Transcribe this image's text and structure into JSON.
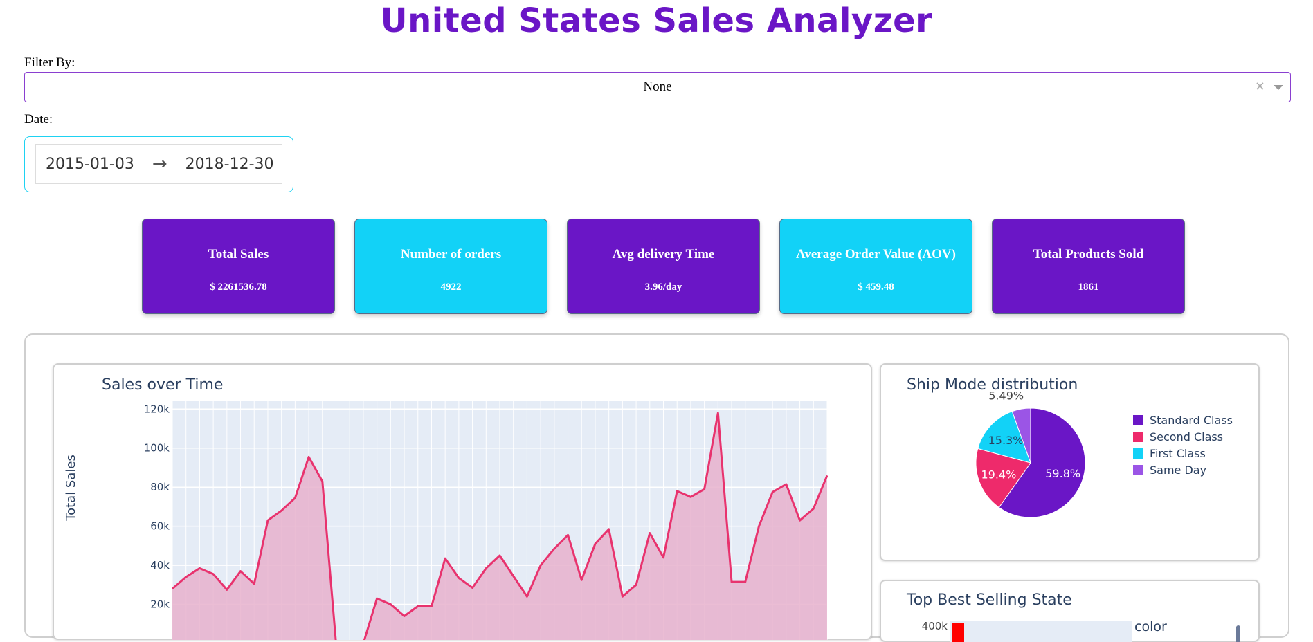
{
  "header": {
    "title": "United States Sales Analyzer"
  },
  "filter": {
    "label": "Filter By:",
    "value": "None",
    "clear_glyph": "×"
  },
  "date": {
    "label": "Date:",
    "start": "2015-01-03",
    "arrow": "→",
    "end": "2018-12-30"
  },
  "kpis": [
    {
      "title": "Total Sales",
      "value": "$ 2261536.78",
      "color": "#6a16c6"
    },
    {
      "title": "Number of orders",
      "value": "4922",
      "color": "#12d2f7"
    },
    {
      "title": "Avg delivery Time",
      "value": "3.96/day",
      "color": "#6a16c6"
    },
    {
      "title": "Average Order Value (AOV)",
      "value": "$ 459.48",
      "color": "#12d2f7"
    },
    {
      "title": "Total Products Sold",
      "value": "1861",
      "color": "#6a16c6"
    }
  ],
  "sales_chart": {
    "title": "Sales over Time"
  },
  "pie_chart": {
    "title": "Ship Mode distribution"
  },
  "state_chart": {
    "title": "Top Best Selling State",
    "legend_title": "color"
  },
  "chart_data": [
    {
      "type": "area",
      "title": "Sales over Time",
      "ylabel": "Total Sales",
      "xlabel": "",
      "ylim": [
        0,
        124000
      ],
      "yticks": [
        "20k",
        "40k",
        "60k",
        "80k",
        "100k",
        "120k"
      ],
      "ytick_values": [
        20000,
        40000,
        60000,
        80000,
        100000,
        120000
      ],
      "grid": true,
      "color": "#e8336e",
      "fill": "#e8b1cc",
      "values": [
        28000,
        34000,
        38500,
        35500,
        27500,
        37000,
        30500,
        63000,
        68000,
        74500,
        95500,
        83000,
        0,
        0,
        0,
        23000,
        20000,
        14000,
        19000,
        19000,
        43500,
        33500,
        28500,
        38500,
        45000,
        34500,
        24000,
        40000,
        48500,
        55500,
        32500,
        51000,
        58500,
        24000,
        30000,
        56500,
        44000,
        78000,
        75000,
        79000,
        118000,
        31500,
        31500,
        60000,
        77500,
        81500,
        63000,
        69000,
        86000
      ]
    },
    {
      "type": "pie",
      "title": "Ship Mode distribution",
      "labels": [
        "Standard Class",
        "Second Class",
        "First Class",
        "Same Day"
      ],
      "values": [
        59.8,
        19.4,
        15.3,
        5.49
      ],
      "display": [
        "59.8%",
        "19.4%",
        "15.3%",
        "5.49%"
      ],
      "colors": [
        "#6a16c6",
        "#ee2a6b",
        "#12d2f7",
        "#9b55e6"
      ],
      "legend": "right"
    },
    {
      "type": "bar",
      "title": "Top Best Selling State",
      "yticks": [
        "400k"
      ],
      "ytick_values": [
        400000
      ],
      "legend_title": "color",
      "bar_color": "#ff0000",
      "partially_visible": true
    }
  ]
}
